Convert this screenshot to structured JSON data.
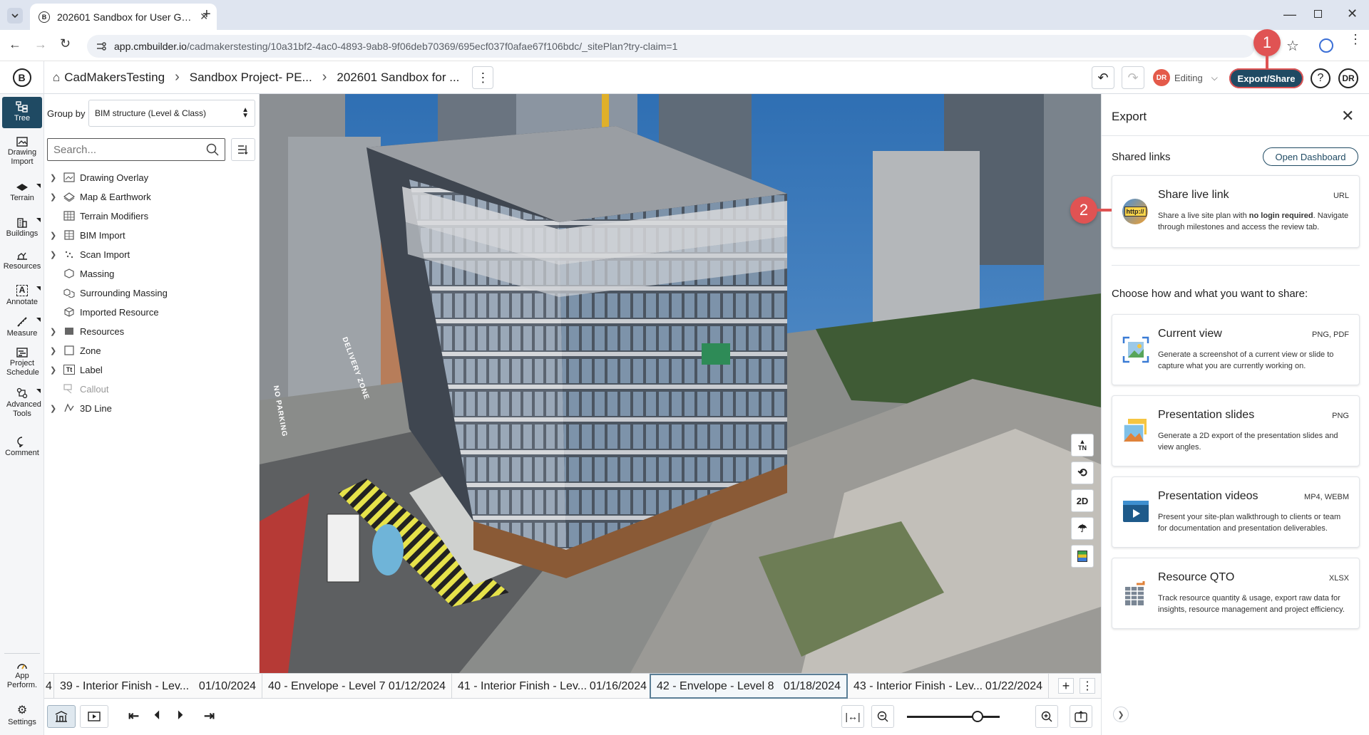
{
  "browser": {
    "tab_title": "202601 Sandbox for User Guide",
    "url_host": "app.cmbuilder.io",
    "url_path": "/cadmakerstesting/10a31bf2-4ac0-4893-9ab8-9f06deb70369/695ecf037f0afae67f106bdc/_sitePlan?try-claim=1"
  },
  "header": {
    "breadcrumb": [
      "CadMakersTesting",
      "Sandbox Project- PE...",
      "202601 Sandbox for ..."
    ],
    "user_initials": "DR",
    "mode_label": "Editing",
    "export_label": "Export/Share",
    "help_label": "?"
  },
  "rail": {
    "items": [
      {
        "label": "Tree",
        "icon": "tree-icon"
      },
      {
        "label": "Drawing Import",
        "icon": "drawing-import-icon"
      },
      {
        "label": "Terrain",
        "icon": "terrain-icon"
      },
      {
        "label": "Buildings",
        "icon": "buildings-icon"
      },
      {
        "label": "Resources",
        "icon": "resources-icon"
      },
      {
        "label": "Annotate",
        "icon": "annotate-icon"
      },
      {
        "label": "Measure",
        "icon": "measure-icon"
      },
      {
        "label": "Project Schedule",
        "icon": "schedule-icon"
      },
      {
        "label": "Advanced Tools",
        "icon": "advanced-tools-icon"
      },
      {
        "label": "Comment",
        "icon": "comment-icon"
      },
      {
        "label": "App Perform.",
        "icon": "gauge-icon"
      },
      {
        "label": "Settings",
        "icon": "gear-icon"
      }
    ]
  },
  "tree": {
    "group_by_label": "Group by",
    "group_by_value": "BIM structure (Level & Class)",
    "search_placeholder": "Search...",
    "nodes": [
      "Drawing Overlay",
      "Map & Earthwork",
      "Terrain Modifiers",
      "BIM Import",
      "Scan Import",
      "Massing",
      "Surrounding Massing",
      "Imported Resource",
      "Resources",
      "Zone",
      "Label",
      "Callout",
      "3D Line"
    ]
  },
  "scene": {
    "tools": [
      "TN",
      "2D"
    ],
    "street_labels": [
      "DELIVERY ZONE",
      "NO PARKING"
    ]
  },
  "timeline": {
    "milestones": [
      {
        "name": "4",
        "date": ""
      },
      {
        "name": "39 - Interior Finish - Lev...",
        "date": "01/10/2024"
      },
      {
        "name": "40 - Envelope - Level 7",
        "date": "01/12/2024"
      },
      {
        "name": "41 - Interior Finish - Lev...",
        "date": "01/16/2024"
      },
      {
        "name": "42 - Envelope - Level 8",
        "date": "01/18/2024"
      },
      {
        "name": "43 - Interior Finish - Lev...",
        "date": "01/22/2024"
      }
    ],
    "zoom_fraction": 0.76
  },
  "export_panel": {
    "title": "Export",
    "shared_links_label": "Shared links",
    "open_dashboard_label": "Open Dashboard",
    "live_link": {
      "title": "Share live link",
      "format": "URL",
      "desc_pre": "Share a live site plan with ",
      "desc_bold": "no login required",
      "desc_post": ". Navigate through milestones and access the review tab.",
      "icon_text": "http://"
    },
    "choose_label": "Choose how and what you want to share:",
    "options": [
      {
        "title": "Current view",
        "format": "PNG, PDF",
        "desc": "Generate a screenshot of a current view or slide to capture what you are currently working on."
      },
      {
        "title": "Presentation slides",
        "format": "PNG",
        "desc": "Generate a 2D export of the presentation slides and view angles."
      },
      {
        "title": "Presentation videos",
        "format": "MP4, WEBM",
        "desc": "Present your site-plan walkthrough to clients or team for documentation and presentation deliverables."
      },
      {
        "title": "Resource QTO",
        "format": "XLSX",
        "desc": "Track resource quantity & usage, export raw data for insights, resource management and project efficiency."
      }
    ]
  },
  "callouts": [
    "1",
    "2"
  ],
  "colors": {
    "accent": "#1f4a63",
    "callout": "#e05353",
    "avatar": "#e45a4a"
  }
}
